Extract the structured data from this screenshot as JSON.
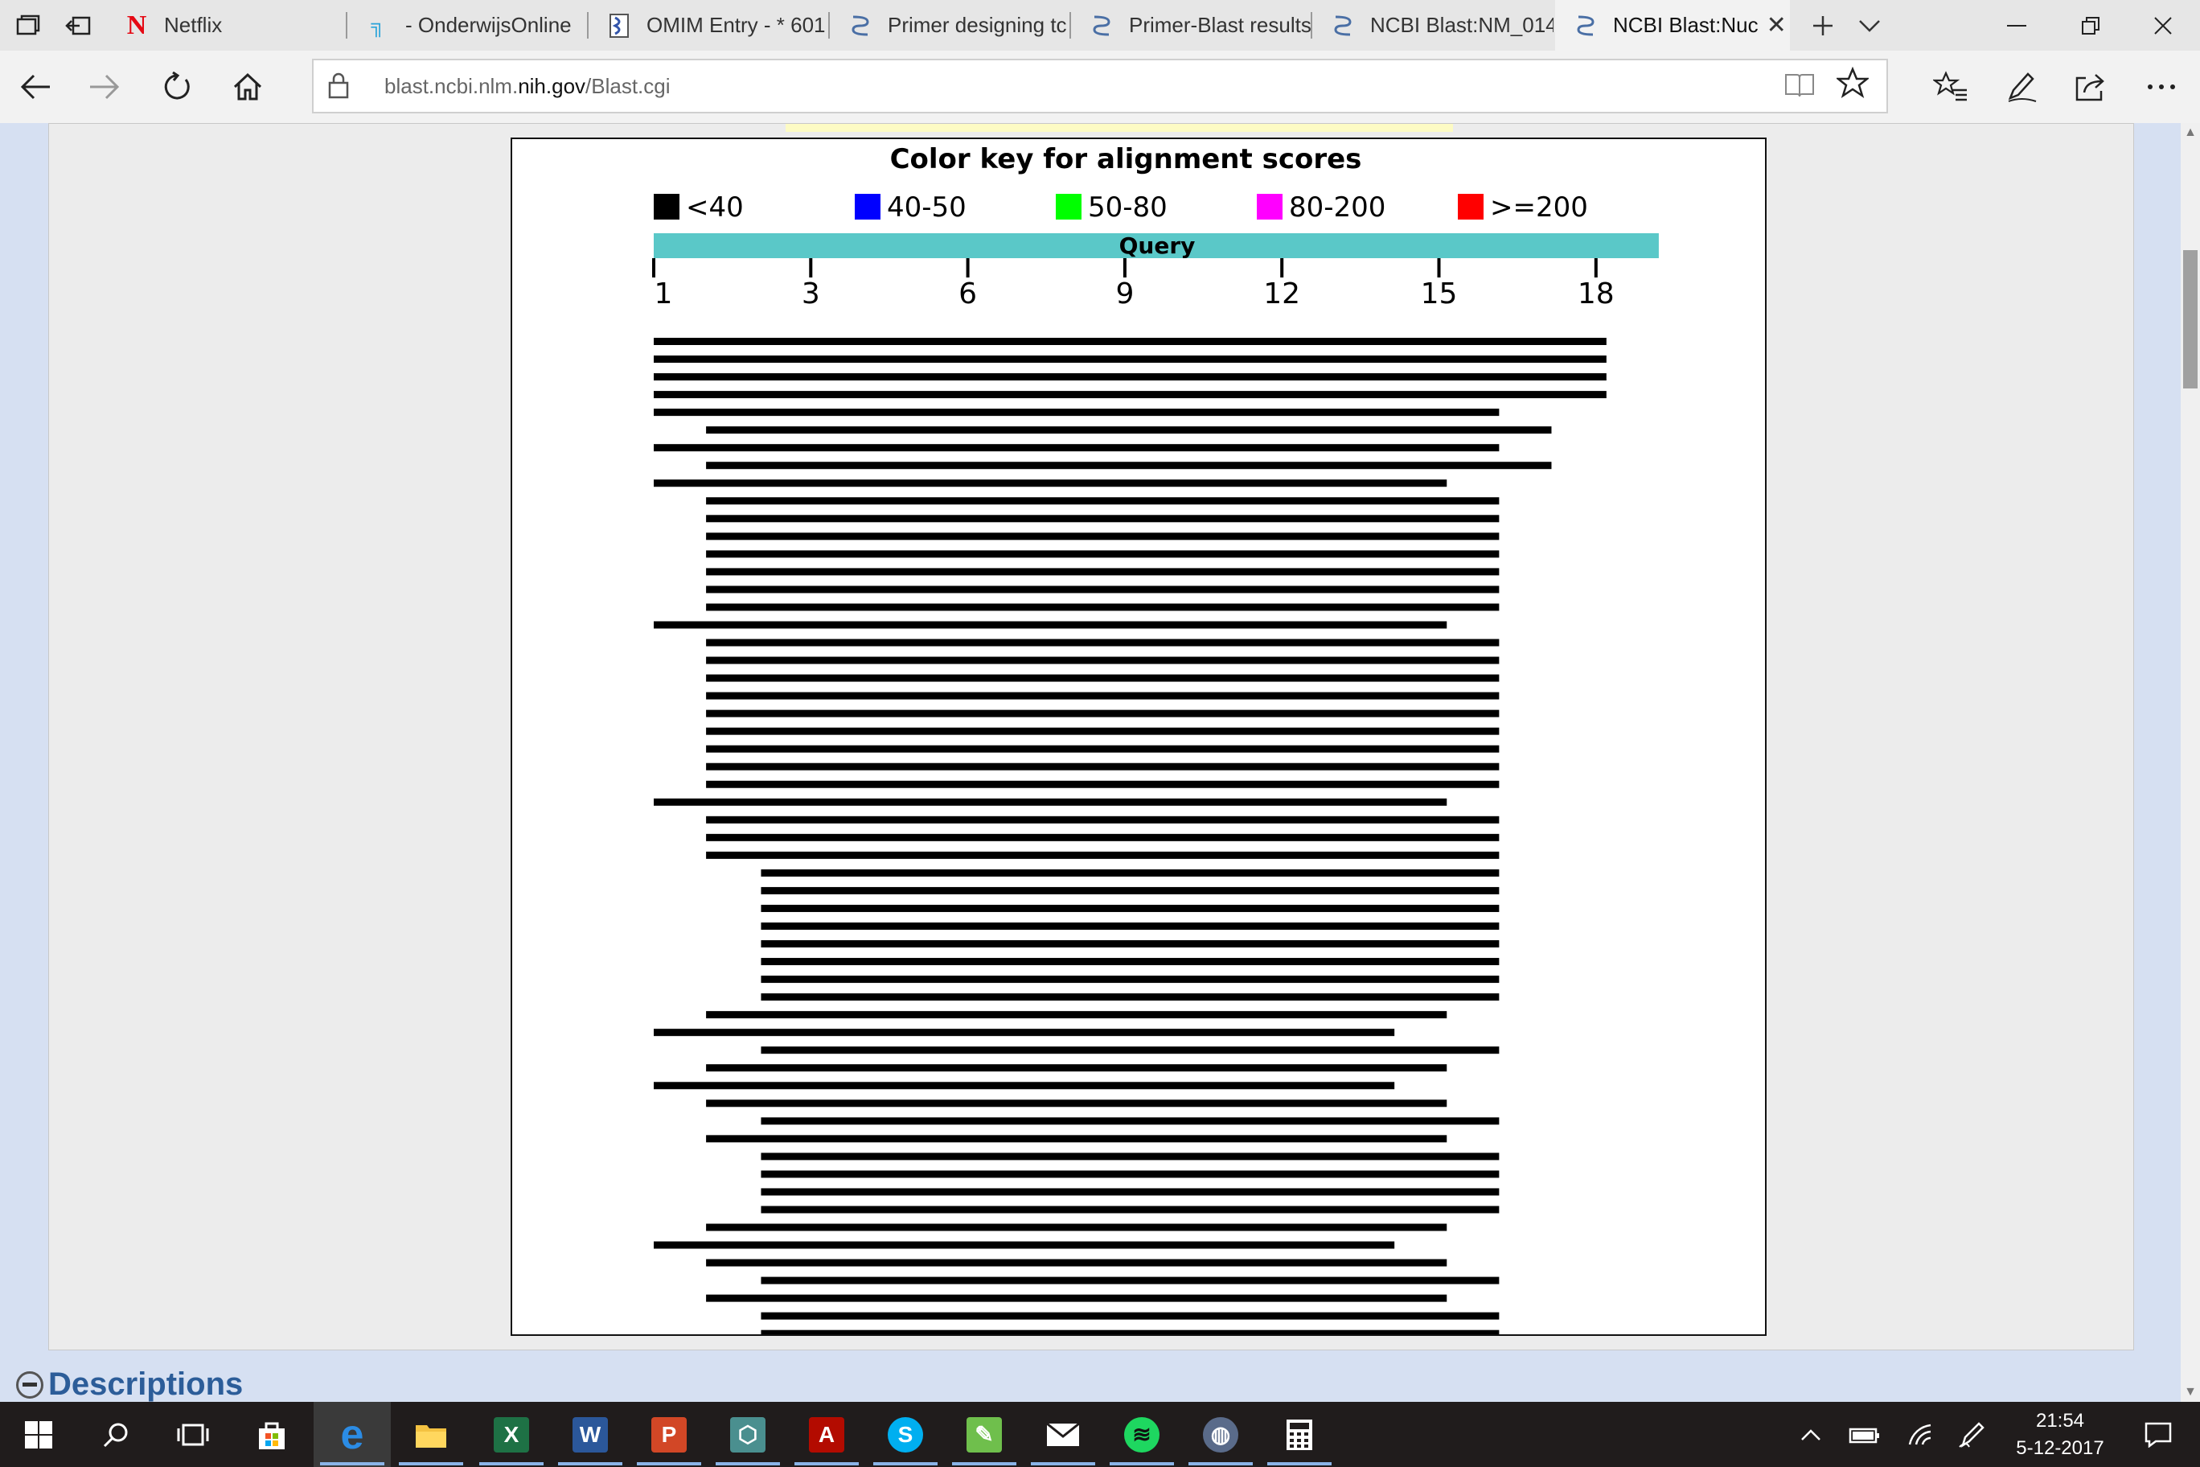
{
  "tabs": [
    {
      "label": "Netflix",
      "icon": "netflix-icon"
    },
    {
      "label": "- OnderwijsOnline",
      "icon": "onderwijsonline-icon"
    },
    {
      "label": "OMIM Entry - * 601",
      "icon": "omim-icon"
    },
    {
      "label": "Primer designing tc",
      "icon": "ncbi-icon"
    },
    {
      "label": "Primer-Blast results",
      "icon": "ncbi-icon"
    },
    {
      "label": "NCBI Blast:NM_014",
      "icon": "ncbi-icon"
    },
    {
      "label": "NCBI Blast:Nuc",
      "icon": "ncbi-icon",
      "active": true
    }
  ],
  "address": {
    "prefix": "blast.ncbi.nlm.",
    "domain": "nih.gov",
    "path": "/Blast.cgi"
  },
  "chart_data": {
    "type": "alignment-graphic",
    "title": "Color key for alignment scores",
    "legend": [
      {
        "label": "<40",
        "color": "#000000"
      },
      {
        "label": "40-50",
        "color": "#0000ff"
      },
      {
        "label": "50-80",
        "color": "#00ff00"
      },
      {
        "label": "80-200",
        "color": "#ff00ff"
      },
      {
        "label": ">=200",
        "color": "#ff0000"
      }
    ],
    "query_label": "Query",
    "query_color": "#5ac8c8",
    "axis": {
      "ticks": [
        1,
        3,
        6,
        9,
        12,
        15,
        18
      ],
      "range": [
        0,
        19.2
      ]
    },
    "hits": [
      {
        "start": 0,
        "end": 18.2
      },
      {
        "start": 0,
        "end": 18.2
      },
      {
        "start": 0,
        "end": 18.2
      },
      {
        "start": 0,
        "end": 18.2
      },
      {
        "start": 0,
        "end": 16.15
      },
      {
        "start": 1,
        "end": 17.15
      },
      {
        "start": 0,
        "end": 16.15
      },
      {
        "start": 1,
        "end": 17.15
      },
      {
        "start": 0,
        "end": 15.15
      },
      {
        "start": 1,
        "end": 16.15
      },
      {
        "start": 1,
        "end": 16.15
      },
      {
        "start": 1,
        "end": 16.15
      },
      {
        "start": 1,
        "end": 16.15
      },
      {
        "start": 1,
        "end": 16.15
      },
      {
        "start": 1,
        "end": 16.15
      },
      {
        "start": 1,
        "end": 16.15
      },
      {
        "start": 0,
        "end": 15.15
      },
      {
        "start": 1,
        "end": 16.15
      },
      {
        "start": 1,
        "end": 16.15
      },
      {
        "start": 1,
        "end": 16.15
      },
      {
        "start": 1,
        "end": 16.15
      },
      {
        "start": 1,
        "end": 16.15
      },
      {
        "start": 1,
        "end": 16.15
      },
      {
        "start": 1,
        "end": 16.15
      },
      {
        "start": 1,
        "end": 16.15
      },
      {
        "start": 1,
        "end": 16.15
      },
      {
        "start": 0,
        "end": 15.15
      },
      {
        "start": 1,
        "end": 16.15
      },
      {
        "start": 1,
        "end": 16.15
      },
      {
        "start": 1,
        "end": 16.15
      },
      {
        "start": 2.05,
        "end": 16.15
      },
      {
        "start": 2.05,
        "end": 16.15
      },
      {
        "start": 2.05,
        "end": 16.15
      },
      {
        "start": 2.05,
        "end": 16.15
      },
      {
        "start": 2.05,
        "end": 16.15
      },
      {
        "start": 2.05,
        "end": 16.15
      },
      {
        "start": 2.05,
        "end": 16.15
      },
      {
        "start": 2.05,
        "end": 16.15
      },
      {
        "start": 1,
        "end": 15.15
      },
      {
        "start": 0,
        "end": 14.15
      },
      {
        "start": 2.05,
        "end": 16.15
      },
      {
        "start": 1,
        "end": 15.15
      },
      {
        "start": 0,
        "end": 14.15
      },
      {
        "start": 1,
        "end": 15.15
      },
      {
        "start": 2.05,
        "end": 16.15
      },
      {
        "start": 1,
        "end": 15.15
      },
      {
        "start": 2.05,
        "end": 16.15
      },
      {
        "start": 2.05,
        "end": 16.15
      },
      {
        "start": 2.05,
        "end": 16.15
      },
      {
        "start": 2.05,
        "end": 16.15
      },
      {
        "start": 1,
        "end": 15.15
      },
      {
        "start": 0,
        "end": 14.15
      },
      {
        "start": 1,
        "end": 15.15
      },
      {
        "start": 2.05,
        "end": 16.15
      },
      {
        "start": 1,
        "end": 15.15
      },
      {
        "start": 2.05,
        "end": 16.15
      },
      {
        "start": 2.05,
        "end": 16.15
      }
    ]
  },
  "descriptions_label": "Descriptions",
  "clock": {
    "time": "21:54",
    "date": "5-12-2017"
  }
}
